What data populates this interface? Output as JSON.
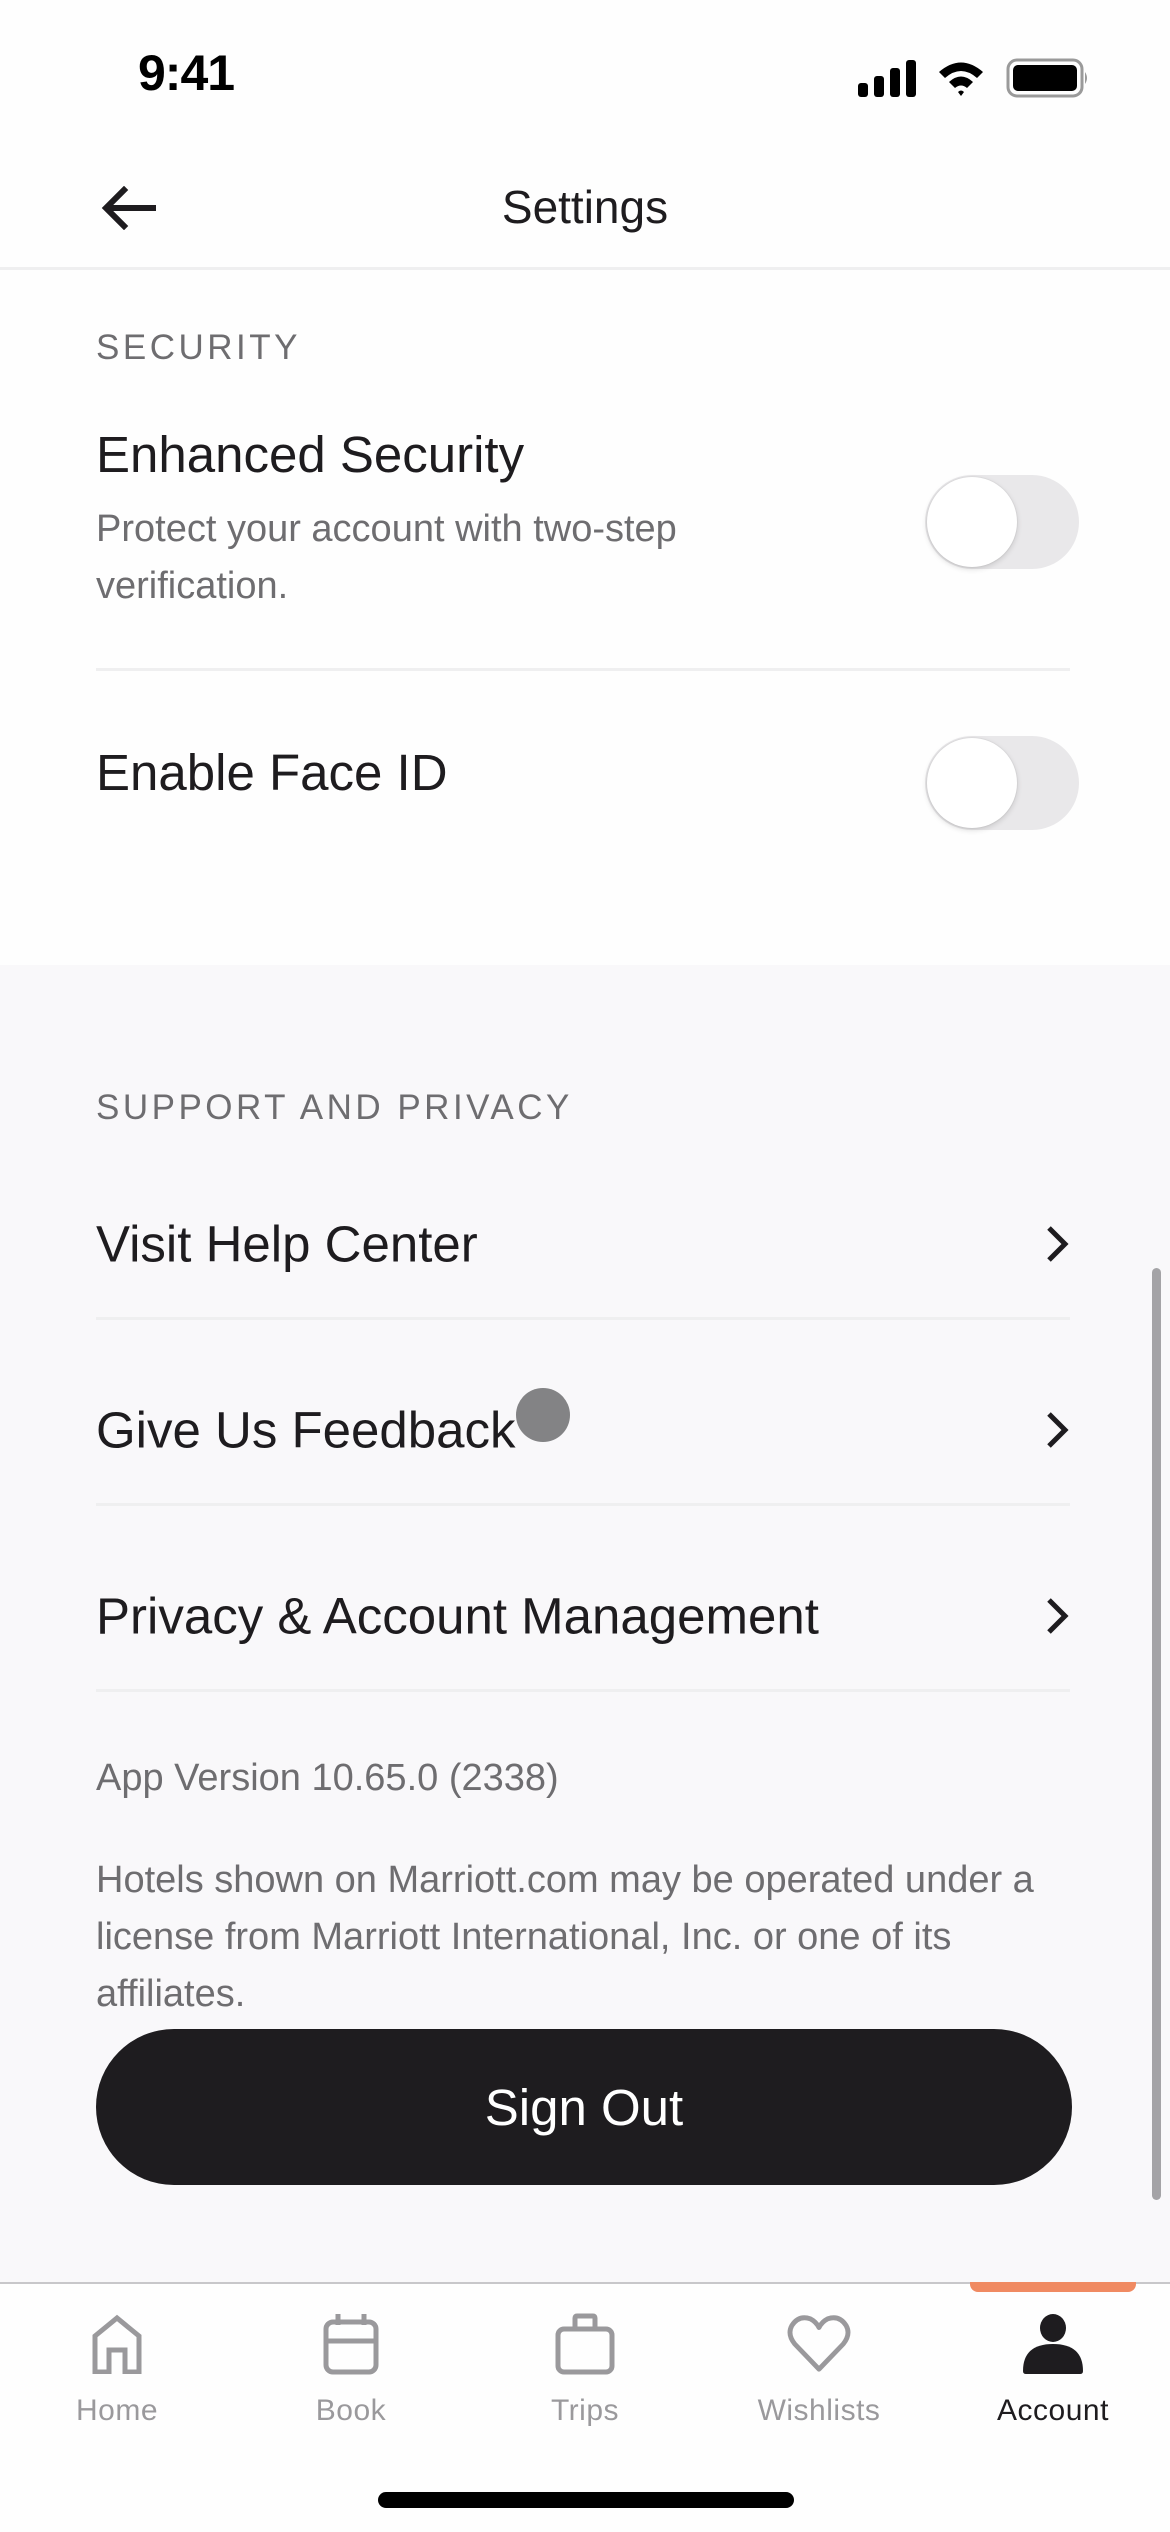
{
  "status_bar": {
    "time": "9:41",
    "icons": [
      "cellular-signal-icon",
      "wifi-icon",
      "battery-icon"
    ]
  },
  "header": {
    "title": "Settings",
    "back_icon": "arrow-left-icon"
  },
  "security": {
    "section_label": "SECURITY",
    "items": [
      {
        "title": "Enhanced Security",
        "description": "Protect your account with two-step verification.",
        "toggle_on": false
      },
      {
        "title": "Enable Face ID",
        "toggle_on": false
      }
    ]
  },
  "support": {
    "section_label": "SUPPORT AND PRIVACY",
    "items": [
      {
        "label": "Visit Help Center",
        "icon": "chevron-right-icon"
      },
      {
        "label": "Give Us Feedback",
        "icon": "chevron-right-icon"
      },
      {
        "label": "Privacy & Account Management",
        "icon": "chevron-right-icon"
      }
    ]
  },
  "footer": {
    "app_version": "App Version 10.65.0 (2338)",
    "legal_text": "Hotels shown on Marriott.com may be operated under a license from Marriott International, Inc. or one of its affiliates.",
    "sign_out_label": "Sign Out"
  },
  "tab_bar": {
    "active_index": 4,
    "accent_color": "#f08a62",
    "tabs": [
      {
        "label": "Home",
        "icon": "home-icon"
      },
      {
        "label": "Book",
        "icon": "calendar-icon"
      },
      {
        "label": "Trips",
        "icon": "briefcase-icon"
      },
      {
        "label": "Wishlists",
        "icon": "heart-icon"
      },
      {
        "label": "Account",
        "icon": "person-icon"
      }
    ]
  },
  "colors": {
    "primary_text": "#1e1c1f",
    "secondary_text": "#6e6d70",
    "inactive_tab": "#9a999c",
    "button_bg": "#1e1c1f",
    "section_gray_bg": "#f9f8fa",
    "toggle_off_track": "#e9e8ea"
  }
}
